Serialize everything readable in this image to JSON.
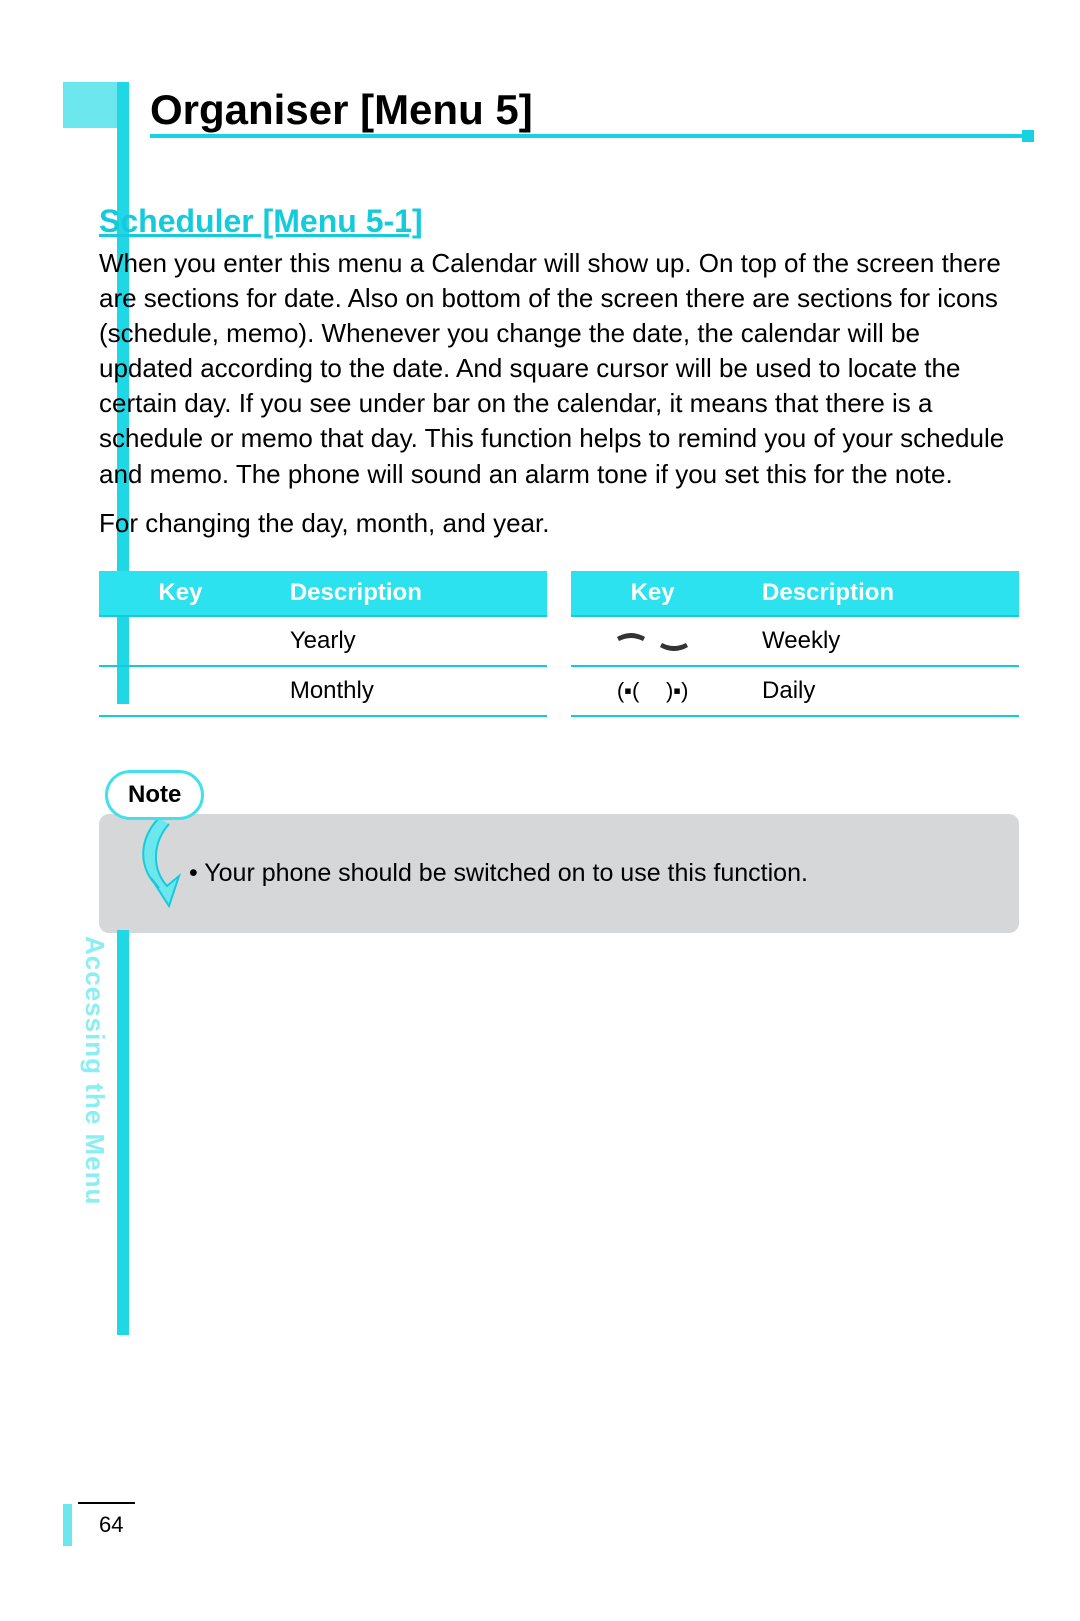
{
  "title": "Organiser [Menu 5]",
  "subtitle": "Scheduler [Menu 5-1]",
  "paragraphs": [
    "When you enter this menu a Calendar will show up. On top of the screen there are sections for date. Also on bottom of the screen there are sections for icons (schedule, memo). Whenever you change the date, the calendar will be updated according to the date. And square cursor will be used to locate the certain day. If you see under bar on the calendar, it means that there is a schedule or memo that day. This function helps to remind you of your schedule and memo. The phone will sound an alarm tone if you set this for the note.",
    "For changing the day, month, and year."
  ],
  "table": {
    "headers": {
      "key": "Key",
      "description": "Description"
    },
    "left_rows": [
      {
        "key_icon": "",
        "description": "Yearly"
      },
      {
        "key_icon": "",
        "description": "Monthly"
      }
    ],
    "right_rows": [
      {
        "key_icon": "send-end",
        "description": "Weekly"
      },
      {
        "key_icon": "soft-left-right",
        "description": "Daily"
      }
    ]
  },
  "note": {
    "label": "Note",
    "text": "Your phone should be switched on to use this function."
  },
  "side_text": "Accessing the Menu",
  "page_number": "64"
}
